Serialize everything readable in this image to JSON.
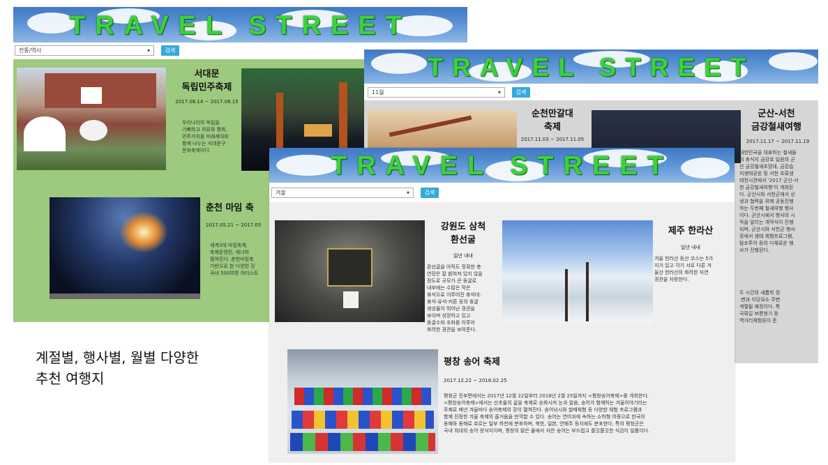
{
  "site": {
    "title": "TRAVEL STREET",
    "search_label": "검색"
  },
  "caption": "계절별, 행사별, 월별 다양한\n추천 여행지",
  "windows": [
    {
      "select_value": "전통/역사",
      "accent_bg": "#9dca7e",
      "cards": [
        {
          "title": "서대문\n독립민주축제",
          "date": "2017.08.14 ~ 2017.08.15",
          "desc": "우리나라의 독립을\n기뻐하고 자유와 평화,\n민주가치를 미래세대와\n함께 나누는 서대문구\n문화축제이다."
        },
        {
          "title": "춘천 마임 축",
          "date": "2017.05.21 ~ 2017.05",
          "desc": "세계3대 마임축제,\n축제운영진, 에너하\n펼쳐진다. 춘천마임축\n기반으로 한 다양한 장\n국내 500여명 아티스트"
        }
      ]
    },
    {
      "select_value": "11월",
      "accent_bg": "#d6d6d6",
      "cards": [
        {
          "title": "순천만갈대\n축제",
          "date": "2017.11.03 ~ 2017.11.05"
        },
        {
          "title": "군산-서천\n금강철새여행",
          "date": "2017.11.17 ~ 2017.11.19",
          "desc": "대한민국을 대표하는 철새들\n의 휴식지 금강호 일원의 군\n산 금강철새조망대, 금강습\n지생태공원 및 서천 조류생\n태전시관에서 '2017 군산-서\n천 금강철새여행'이 개최된\n다. 군산시와 서천군에서 상\n생과 협력을 위해 공동진행\n하는 두번째 철새여행 행사\n이다. 군산시에서 행사의 시\n작을 알리는 개막식이 진행\n되며, 군산시와 서천군 행사\n장에서 생태 체험프로그램,\n탐조투어 등의 다채로운 행\n사가 진행된다."
        },
        {
          "desc": "두 시간의 새롭학 정\n.변과 이당묘소 주변\n계혈될 예정이다. 특\n국확길 보릉청기 등\n역거리체험등이 준"
        }
      ]
    },
    {
      "select_value": "겨울",
      "accent_bg": "#efefef",
      "cards": [
        {
          "title": "강원도 삼척\n환선굴",
          "date": "일년 내내",
          "desc": "환선굴을 아직도 정확한 총\n연장은 잘 밝혀져 있지 않을\n정도로 규모가 큰 동굴로\n내부에는 수많은 작은\n휴석으로 이루어진 휴석대-\n휴석-유석-커튼 등의 동굴\n생성물이 뛰어난 경관을\n보이며 성장하고 있고\n동굴수와 조화를 이루어\n화려한 경관을 보여준다."
        },
        {
          "title": "제주 한라산",
          "date": "일년 내내",
          "desc": "겨울 한라산 등산 코스는 5가\n지가 있고 각기 서로 다른 겨\n울산 한라산의 화려한 자연\n경관을 자랑한다."
        },
        {
          "title": "평창 송어 축제",
          "date": "2017.12.22 ~ 2018.02.25",
          "desc": "평창군 진부면에서는 2017년 12월 22일부터 2018년 2월 25일까지 <평창송어축제>를 개최한다.\n<평창송어축제>에서는 산초들의 삶을 축제로 승화시켜 눈과 얼음, 송어가 함께하는 겨울이야기라는\n주제로 매년 겨울마다 송어축제의 장이 펼쳐진다. 송어낚시와 썰매체험 등 다양한 체험 프로그램과\n함께 진정한 겨울 축제의 즐거움을 만끽할 수 있다. 송어는 연어과에 속하는 소하형 어종으로 한국의\n동해와 동해로 흐르는 일부 하천에 분포하며, 북한, 일본, 연해주 등지에도 분포한다. 특히 평창군은\n국내 최대의 송어 양식지이며, 평창의 맑은 물에서 자란 송어는 부드럽고 쫄깃쫄깃한 식감이 일품이다."
        }
      ]
    }
  ]
}
